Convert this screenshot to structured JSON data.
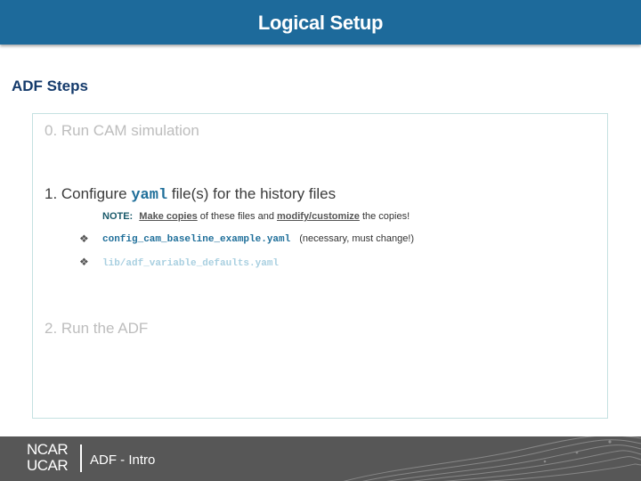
{
  "header": {
    "title": "Logical Setup"
  },
  "section_title": "ADF Steps",
  "steps": {
    "step0": "0. Run CAM simulation",
    "step1": {
      "prefix": "1. Configure ",
      "code": "yaml",
      "suffix": " file(s) for the history files"
    },
    "step2": "2. Run the ADF"
  },
  "note": {
    "label": "NOTE:",
    "part1": "Make copies",
    "part2": " of these files and ",
    "part3": "modify/customize",
    "part4": " the copies!"
  },
  "files": [
    {
      "name": "config_cam_baseline_example.yaml",
      "comment": "(necessary, must change!)"
    },
    {
      "name": "lib/adf_variable_defaults.yaml",
      "comment": ""
    }
  ],
  "bullet_glyph": "❖",
  "footer": {
    "logo_line1": "NCAR",
    "logo_line2": "UCAR",
    "text": "ADF - Intro"
  },
  "colors": {
    "header": "#1d6a9b",
    "footer": "#575757",
    "code": "#1f6f9a",
    "title": "#143a6b"
  }
}
